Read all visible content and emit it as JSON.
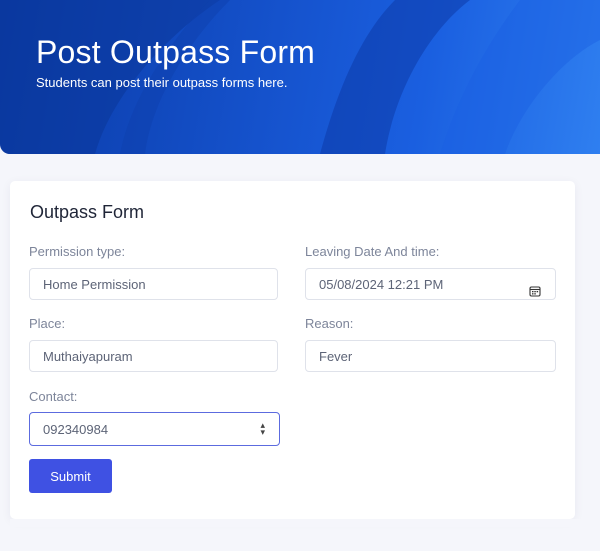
{
  "header": {
    "title": "Post Outpass Form",
    "subtitle": "Students can post their outpass forms here."
  },
  "form": {
    "title": "Outpass Form",
    "permission_type": {
      "label": "Permission type:",
      "value": "Home Permission"
    },
    "leaving_datetime": {
      "label": "Leaving Date And time:",
      "value": "05/08/2024 12:21 PM",
      "icon": "calendar-icon"
    },
    "place": {
      "label": "Place:",
      "value": "Muthaiyapuram"
    },
    "reason": {
      "label": "Reason:",
      "value": "Fever"
    },
    "contact": {
      "label": "Contact:",
      "value": "092340984",
      "icon": "spinner-icon"
    },
    "submit_label": "Submit"
  },
  "colors": {
    "header_blue": "#1552cc",
    "button_blue": "#3f51e3",
    "focus_border": "#5c6bdf"
  }
}
